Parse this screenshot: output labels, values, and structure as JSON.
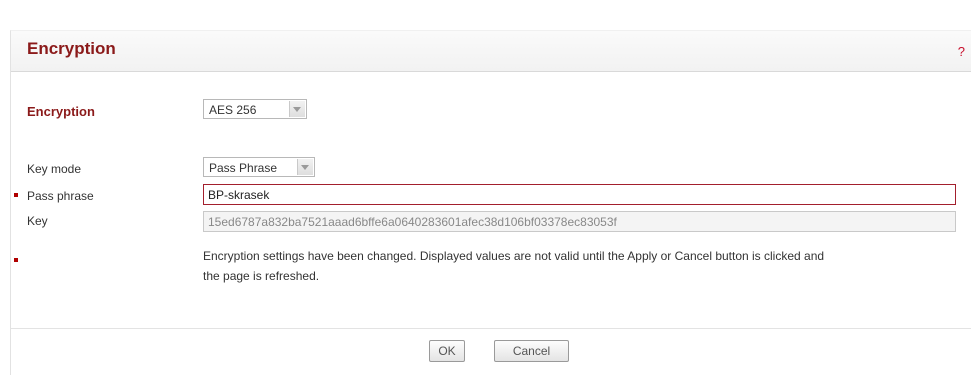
{
  "header": {
    "title": "Encryption",
    "help_label": "?"
  },
  "form": {
    "encryption": {
      "label": "Encryption",
      "selected": "AES 256"
    },
    "key_mode": {
      "label": "Key mode",
      "selected": "Pass Phrase"
    },
    "pass_phrase": {
      "label": "Pass phrase",
      "value": "BP-skrasek"
    },
    "key": {
      "label": "Key",
      "value": "15ed6787a832ba7521aaad6bffe6a0640283601afec38d106bf03378ec83053f"
    },
    "notice": {
      "line1": "Encryption settings have been changed. Displayed values are not valid until the Apply or Cancel button is clicked and",
      "line2": "the page is refreshed."
    }
  },
  "buttons": {
    "ok": "OK",
    "cancel": "Cancel"
  },
  "colors": {
    "accent": "#8b1a1a",
    "help": "#c8102e",
    "required_marker": "#b00000"
  }
}
